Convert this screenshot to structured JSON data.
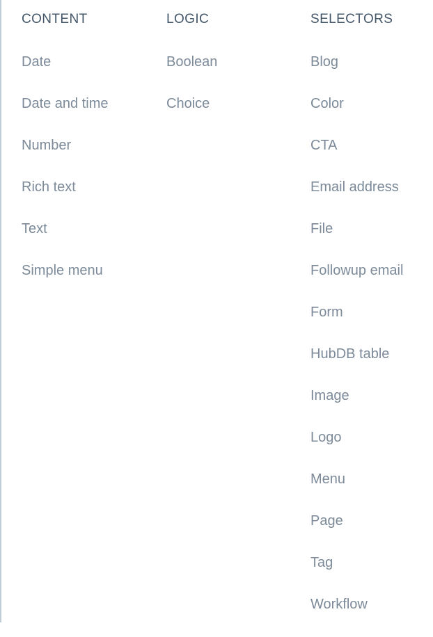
{
  "page": {
    "background_color": "#ffffff",
    "left_rule_color": "#bfcdd9",
    "header_color": "#45586a",
    "item_color": "#7c8a99"
  },
  "columns": [
    {
      "header": "CONTENT",
      "items": [
        {
          "label": "Date"
        },
        {
          "label": "Date and time"
        },
        {
          "label": "Number"
        },
        {
          "label": "Rich text"
        },
        {
          "label": "Text"
        },
        {
          "label": "Simple menu"
        }
      ]
    },
    {
      "header": "LOGIC",
      "items": [
        {
          "label": "Boolean"
        },
        {
          "label": "Choice"
        }
      ]
    },
    {
      "header": "SELECTORS",
      "items": [
        {
          "label": "Blog"
        },
        {
          "label": "Color"
        },
        {
          "label": "CTA"
        },
        {
          "label": "Email address"
        },
        {
          "label": "File"
        },
        {
          "label": "Followup email"
        },
        {
          "label": "Form"
        },
        {
          "label": "HubDB table"
        },
        {
          "label": "Image"
        },
        {
          "label": "Logo"
        },
        {
          "label": "Menu"
        },
        {
          "label": "Page"
        },
        {
          "label": "Tag"
        },
        {
          "label": "Workflow"
        }
      ]
    }
  ]
}
